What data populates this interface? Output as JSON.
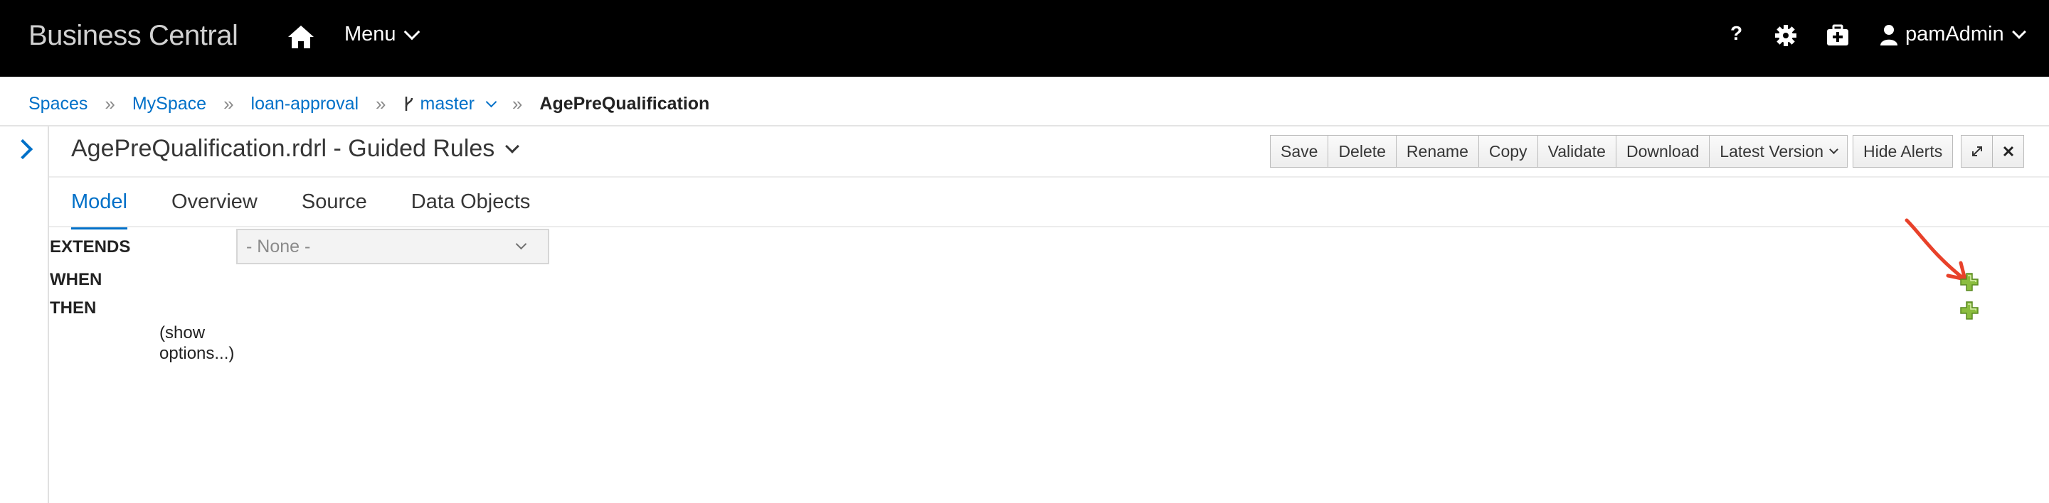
{
  "navbar": {
    "brand": "Business Central",
    "home_icon": "home-icon",
    "menu_label": "Menu",
    "help_label": "?",
    "settings_icon": "gear-icon",
    "apps_icon": "briefcase-icon",
    "user_name": "pamAdmin"
  },
  "breadcrumb": {
    "items": [
      "Spaces",
      "MySpace",
      "loan-approval"
    ],
    "branch": "master",
    "current": "AgePreQualification"
  },
  "editor": {
    "title": "AgePreQualification.rdrl - Guided Rules",
    "toolbar": {
      "save": "Save",
      "delete": "Delete",
      "rename": "Rename",
      "copy": "Copy",
      "validate": "Validate",
      "download": "Download",
      "version": "Latest Version",
      "hide_alerts": "Hide Alerts"
    },
    "tabs": [
      "Model",
      "Overview",
      "Source",
      "Data Objects"
    ],
    "active_tab": "Model"
  },
  "rule": {
    "extends_label": "EXTENDS",
    "extends_value": "- None -",
    "when_label": "WHEN",
    "then_label": "THEN",
    "show_options": "(show options...)"
  },
  "colors": {
    "navbar_bg": "#000000",
    "link": "#0070c8",
    "add_icon": "#8bbd3f",
    "annotation": "#e8412a"
  }
}
